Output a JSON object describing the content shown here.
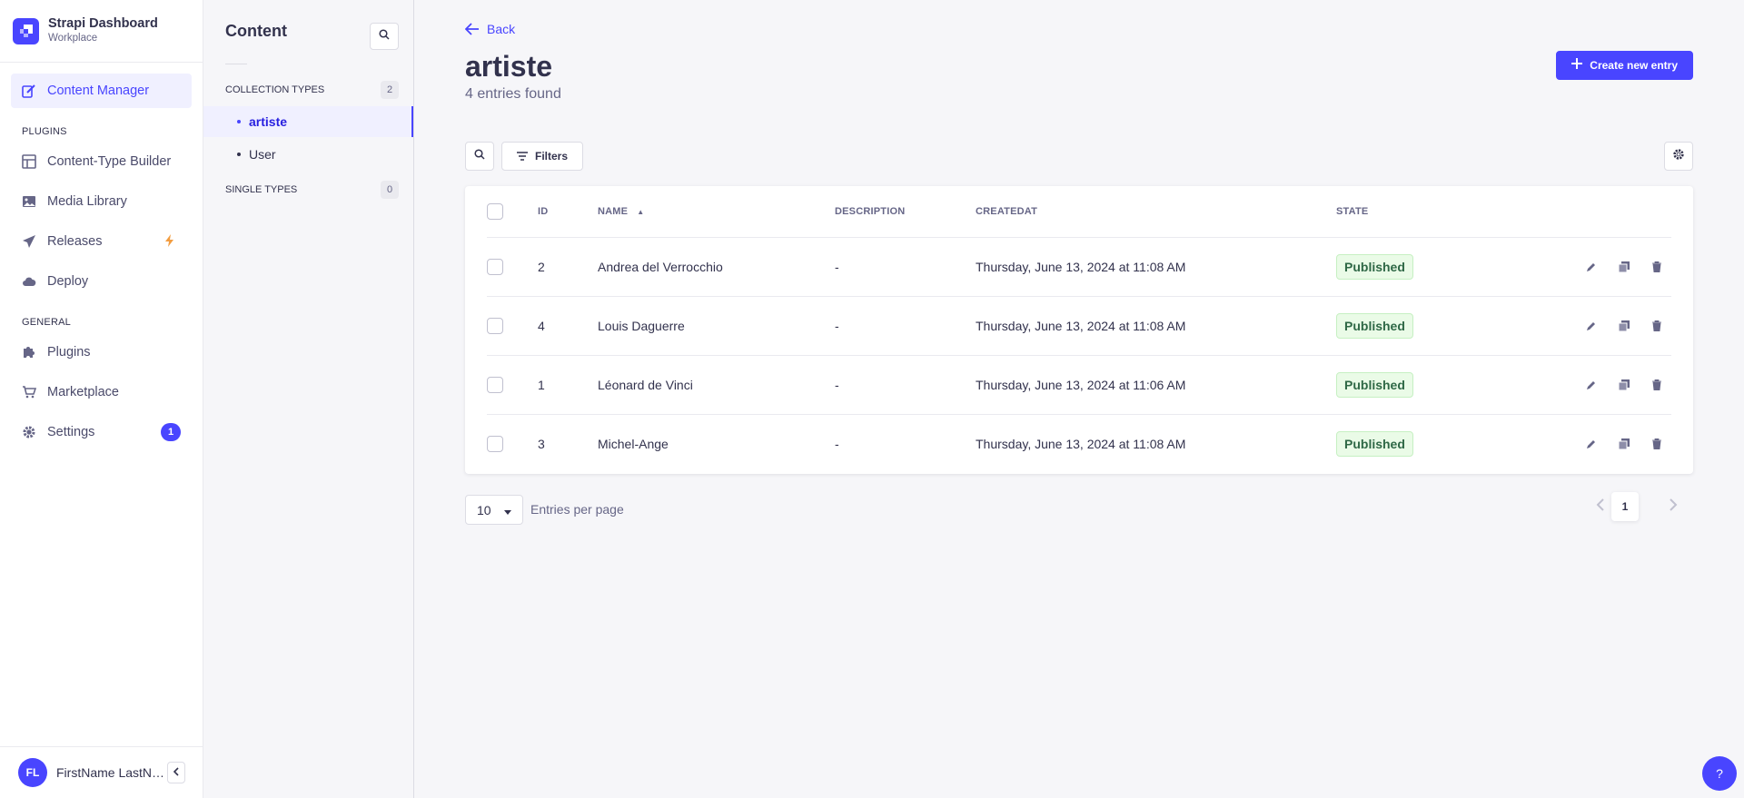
{
  "brand": {
    "title": "Strapi Dashboard",
    "subtitle": "Workplace"
  },
  "mainnav": {
    "content_manager": "Content Manager",
    "plugins_section": "PLUGINS",
    "content_type_builder": "Content-Type Builder",
    "media_library": "Media Library",
    "releases": "Releases",
    "deploy": "Deploy",
    "general_section": "GENERAL",
    "plugins": "Plugins",
    "marketplace": "Marketplace",
    "settings": "Settings",
    "settings_badge": "1"
  },
  "user": {
    "initials": "FL",
    "name": "FirstName LastName"
  },
  "subnav": {
    "title": "Content",
    "collection_types_label": "COLLECTION TYPES",
    "collection_types_count": "2",
    "collection_items": [
      "artiste",
      "User"
    ],
    "single_types_label": "SINGLE TYPES",
    "single_types_count": "0"
  },
  "header": {
    "back_label": "Back",
    "title": "artiste",
    "subtitle": "4 entries found",
    "create_label": "Create new entry"
  },
  "toolbar": {
    "filters_label": "Filters"
  },
  "table": {
    "columns": {
      "id": "ID",
      "name": "NAME",
      "description": "DESCRIPTION",
      "createdat": "CREATEDAT",
      "state": "STATE"
    },
    "rows": [
      {
        "id": "2",
        "name": "Andrea del Verrocchio",
        "description": "-",
        "createdat": "Thursday, June 13, 2024 at 11:08 AM",
        "state": "Published"
      },
      {
        "id": "4",
        "name": "Louis Daguerre",
        "description": "-",
        "createdat": "Thursday, June 13, 2024 at 11:08 AM",
        "state": "Published"
      },
      {
        "id": "1",
        "name": "Léonard de Vinci",
        "description": "-",
        "createdat": "Thursday, June 13, 2024 at 11:06 AM",
        "state": "Published"
      },
      {
        "id": "3",
        "name": "Michel-Ange",
        "description": "-",
        "createdat": "Thursday, June 13, 2024 at 11:08 AM",
        "state": "Published"
      }
    ]
  },
  "pagination": {
    "page_size": "10",
    "page_size_label": "Entries per page",
    "current_page": "1"
  },
  "help": {
    "label": "?"
  },
  "colors": {
    "primary": "#4945ff",
    "success_bg": "#eafbe7",
    "success_text": "#2f6846",
    "warning": "#f29d41"
  },
  "icons": [
    "strapi-logo-icon",
    "feather-icon",
    "layout-icon",
    "image-icon",
    "paper-plane-icon",
    "bolt-icon",
    "cloud-icon",
    "puzzle-icon",
    "cart-icon",
    "gear-icon",
    "search-icon",
    "arrow-left-icon",
    "plus-icon",
    "filter-icon",
    "sort-up-icon",
    "pencil-icon",
    "duplicate-icon",
    "trash-icon",
    "chevron-down-icon",
    "chevron-left-icon",
    "chevron-right-icon"
  ]
}
